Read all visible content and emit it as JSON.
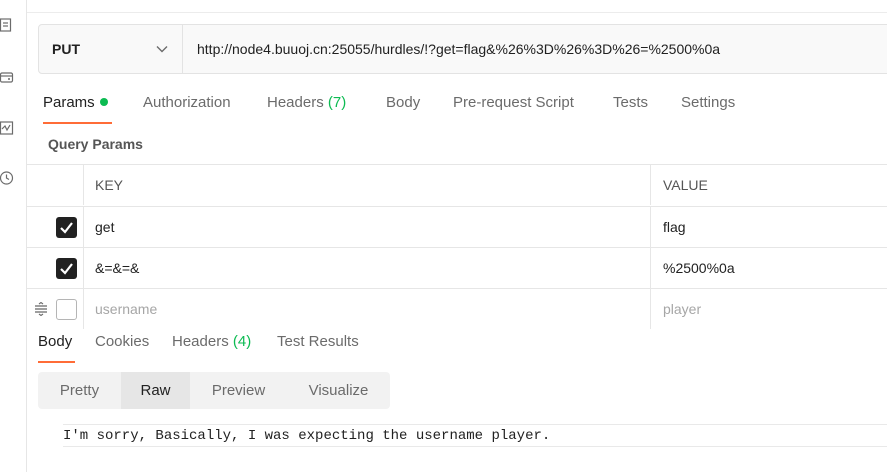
{
  "request": {
    "method": "PUT",
    "url": "http://node4.buuoj.cn:25055/hurdles/!?get=flag&%26%3D%26%3D%26=%2500%0a"
  },
  "request_tabs": [
    {
      "label": "Params",
      "active": true,
      "indicator": "green-dot"
    },
    {
      "label": "Authorization"
    },
    {
      "label": "Headers",
      "count": "(7)"
    },
    {
      "label": "Body"
    },
    {
      "label": "Pre-request Script"
    },
    {
      "label": "Tests"
    },
    {
      "label": "Settings"
    }
  ],
  "query_params": {
    "title": "Query Params",
    "headers": {
      "key": "KEY",
      "value": "VALUE"
    },
    "rows": [
      {
        "key": "get",
        "value": "flag",
        "checked": true
      },
      {
        "key": "&=&=&",
        "value": "%2500%0a",
        "checked": true
      },
      {
        "key": "username",
        "value": "player",
        "checked": false
      }
    ]
  },
  "response_tabs": [
    {
      "label": "Body",
      "active": true
    },
    {
      "label": "Cookies"
    },
    {
      "label": "Headers",
      "count": "(4)"
    },
    {
      "label": "Test Results"
    }
  ],
  "view_modes": [
    {
      "label": "Pretty"
    },
    {
      "label": "Raw",
      "active": true
    },
    {
      "label": "Preview"
    },
    {
      "label": "Visualize"
    }
  ],
  "response_body": "I'm sorry, Basically, I was expecting the username player.",
  "colors": {
    "accent": "#ff6c37",
    "count_green": "#0cbb52",
    "text": "#212121",
    "muted": "#6b6b6b"
  }
}
